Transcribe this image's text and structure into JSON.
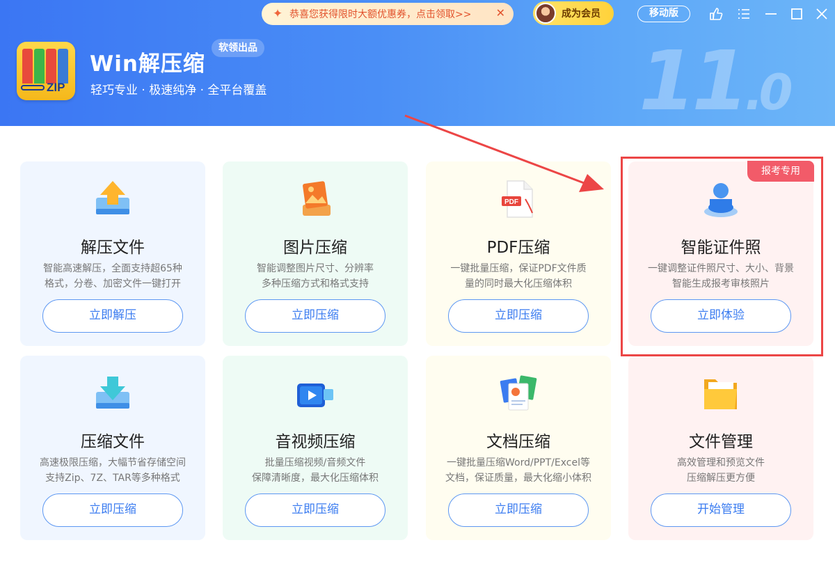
{
  "header": {
    "app_name": "Win解压缩",
    "badge": "软领出品",
    "tagline": "轻巧专业 · 极速纯净 · 全平台覆盖",
    "version_major": "11",
    "version_minor": ".0",
    "promo_text": "恭喜您获得限时大额优惠券，点击领取>>",
    "promo_close": "✕",
    "vip_label": "成为会员",
    "mobile_label": "移动版",
    "logo_text": "ZIP"
  },
  "colors": {
    "header_start": "#3b76f3",
    "header_end": "#6cb5f8",
    "button_border": "#5c97f2",
    "button_text": "#3b7cf0",
    "highlight": "#ec4646",
    "tag": "#f25b69"
  },
  "cards": [
    {
      "title": "解压文件",
      "desc": "智能高速解压，全面支持超65种\n格式，分卷、加密文件一键打开",
      "button": "立即解压",
      "icon": "extract-icon"
    },
    {
      "title": "图片压缩",
      "desc": "智能调整图片尺寸、分辨率\n多种压缩方式和格式支持",
      "button": "立即压缩",
      "icon": "image-icon"
    },
    {
      "title": "PDF压缩",
      "desc": "一键批量压缩，保证PDF文件质\n量的同时最大化压缩体积",
      "button": "立即压缩",
      "icon": "pdf-icon",
      "icon_text": "PDF"
    },
    {
      "title": "智能证件照",
      "desc": "一键调整证件照尺寸、大小、背景\n智能生成报考审核照片",
      "button": "立即体验",
      "icon": "id-photo-icon",
      "tag": "报考专用"
    },
    {
      "title": "压缩文件",
      "desc": "高速极限压缩，大幅节省存储空间\n支持Zip、7Z、TAR等多种格式",
      "button": "立即压缩",
      "icon": "compress-icon"
    },
    {
      "title": "音视频压缩",
      "desc": "批量压缩视频/音频文件\n保障清晰度，最大化压缩体积",
      "button": "立即压缩",
      "icon": "video-icon"
    },
    {
      "title": "文档压缩",
      "desc": "一键批量压缩Word/PPT/Excel等\n文档，保证质量，最大化缩小体积",
      "button": "立即压缩",
      "icon": "document-icon"
    },
    {
      "title": "文件管理",
      "desc": "高效管理和预览文件\n压缩解压更方便",
      "button": "开始管理",
      "icon": "folder-icon"
    }
  ]
}
